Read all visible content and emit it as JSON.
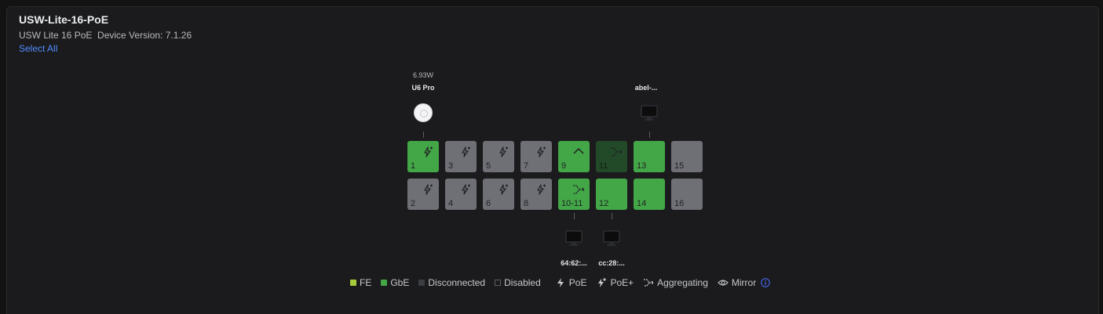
{
  "device": {
    "name": "USW-Lite-16-PoE",
    "subtitle": "USW Lite 16 PoE  Device Version: 7.1.26",
    "select_all": "Select All"
  },
  "ports": [
    {
      "label": "1",
      "state": "gbe",
      "icon": "poe-plus-icon"
    },
    {
      "label": "2",
      "state": "disabled",
      "icon": "poe-plus-icon"
    },
    {
      "label": "3",
      "state": "disabled",
      "icon": "poe-plus-icon"
    },
    {
      "label": "4",
      "state": "disabled",
      "icon": "poe-plus-icon"
    },
    {
      "label": "5",
      "state": "disabled",
      "icon": "poe-plus-icon"
    },
    {
      "label": "6",
      "state": "disabled",
      "icon": "poe-plus-icon"
    },
    {
      "label": "7",
      "state": "disabled",
      "icon": "poe-plus-icon"
    },
    {
      "label": "8",
      "state": "disabled",
      "icon": "poe-plus-icon"
    },
    {
      "label": "9",
      "state": "gbe",
      "icon": "chevron-up-icon"
    },
    {
      "label": "10-11",
      "state": "gbe",
      "icon": "aggregating-icon"
    },
    {
      "label": "11",
      "state": "aggregated",
      "icon": "aggregating-icon"
    },
    {
      "label": "12",
      "state": "gbe",
      "icon": ""
    },
    {
      "label": "13",
      "state": "gbe",
      "icon": ""
    },
    {
      "label": "14",
      "state": "gbe",
      "icon": ""
    },
    {
      "label": "15",
      "state": "disabled",
      "icon": ""
    },
    {
      "label": "16",
      "state": "disabled",
      "icon": ""
    }
  ],
  "devices": {
    "port1": {
      "power": "6.93W",
      "name": "U6 Pro",
      "icon": "access-point-icon"
    },
    "port13": {
      "name": "abel-...",
      "icon": "monitor-icon"
    },
    "port10": {
      "name": "64:62:...",
      "icon": "monitor-icon"
    },
    "port12": {
      "name": "cc:28:...",
      "icon": "monitor-icon"
    }
  },
  "legend": {
    "fe": "FE",
    "gbe": "GbE",
    "disconnected": "Disconnected",
    "disabled": "Disabled",
    "poe": "PoE",
    "poe_plus": "PoE+",
    "aggregating": "Aggregating",
    "mirror": "Mirror"
  },
  "colors": {
    "gbe": "#43a748",
    "fe": "#a6cc3c",
    "disabled": "#6f6f76",
    "aggregated": "#234a28",
    "link": "#4f8cff"
  }
}
